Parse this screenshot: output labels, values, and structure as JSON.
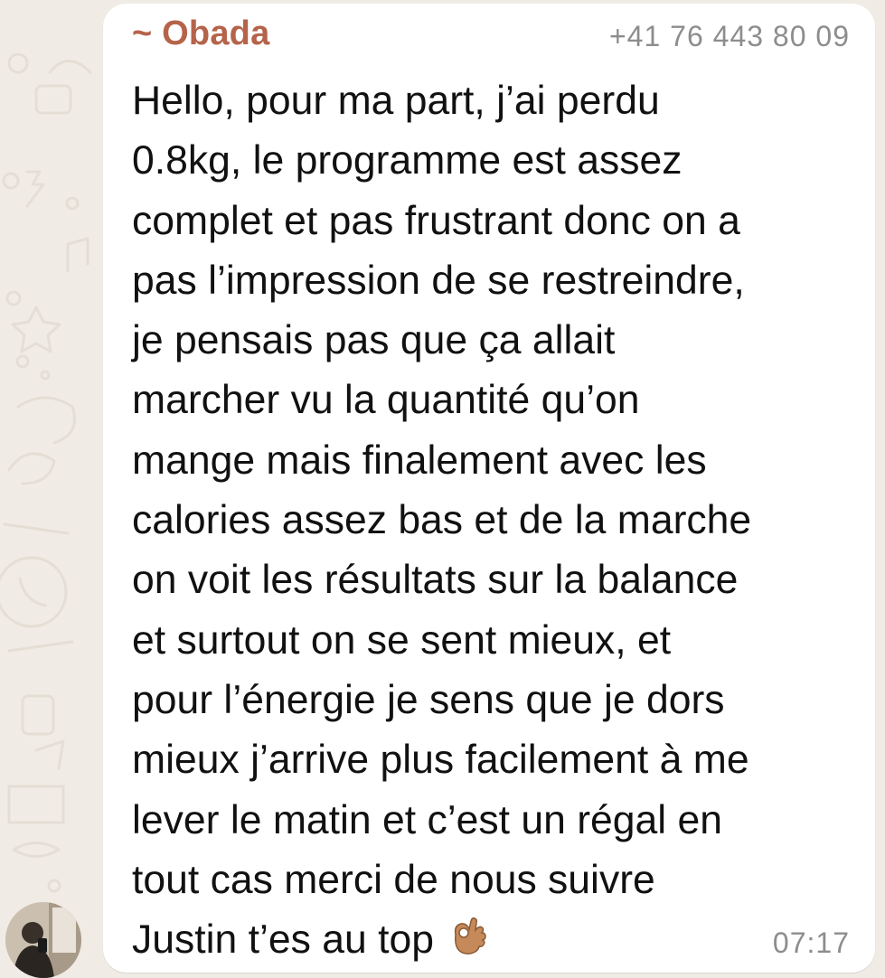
{
  "chat": {
    "sender_name": "~ Obada",
    "sender_phone": "+41 76 443 80 09",
    "message_lines": [
      "Hello, pour ma part, j’ai perdu",
      "0.8kg, le programme est assez",
      "complet et pas frustrant donc on a",
      "pas l’impression de se restreindre,",
      "je pensais pas que ça allait",
      "marcher vu la quantité qu’on",
      "mange mais finalement avec les",
      "calories assez bas et de la marche",
      "on voit les résultats sur la balance",
      "et surtout on se sent mieux, et",
      "pour l’énergie je sens que je dors",
      "mieux j’arrive plus facilement à me",
      "lever le matin et c’est un régal en",
      "tout cas merci de nous suivre",
      "Justin t’es au top"
    ],
    "emoji": "ok-hand-medium-skin-tone",
    "time": "07:17"
  },
  "colors": {
    "sender_name": "#b5634a",
    "meta_text": "#8d8d8d",
    "bubble": "#ffffff",
    "wallpaper": "#f0ece5"
  }
}
